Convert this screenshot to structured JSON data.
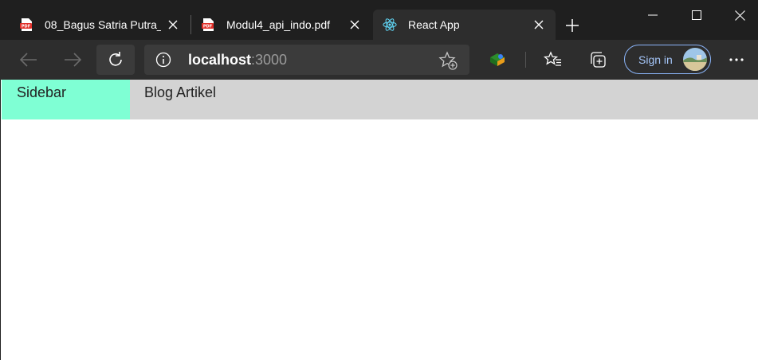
{
  "browser": {
    "tabs": [
      {
        "title": "08_Bagus Satria Putra_",
        "icon": "pdf-icon"
      },
      {
        "title": "Modul4_api_indo.pdf",
        "icon": "pdf-icon"
      },
      {
        "title": "React App",
        "icon": "react-icon",
        "active": true
      }
    ],
    "pdf_icon_label": "PDF",
    "address": {
      "host": "localhost",
      "port": ":3000"
    },
    "signin_label": "Sign in",
    "accent_color": "#8ab4f8"
  },
  "page": {
    "sidebar_label": "Sidebar",
    "header_title": "Blog Artikel",
    "sidebar_color": "#7fffd4",
    "header_color": "#d3d3d3"
  }
}
